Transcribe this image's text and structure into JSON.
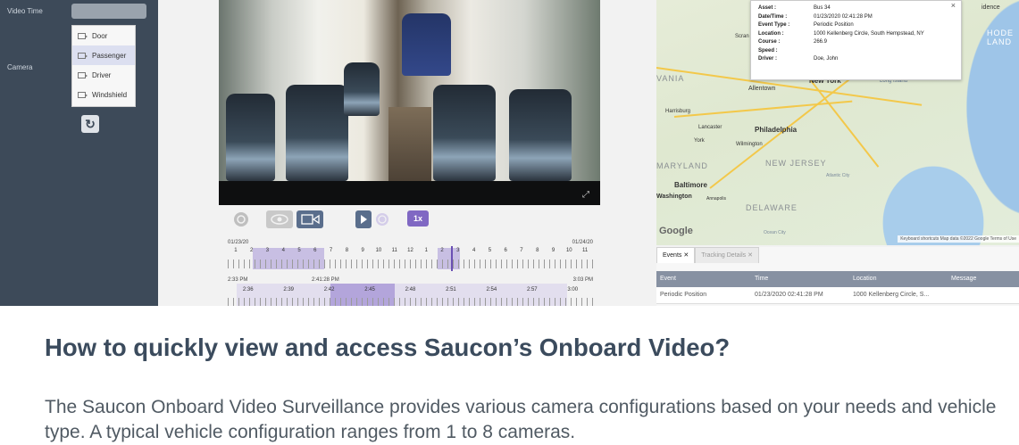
{
  "left_panel": {
    "video_time_label": "Video Time",
    "camera_label": "Camera",
    "cameras": [
      "Door",
      "Passenger",
      "Driver",
      "Windshield"
    ],
    "selected_camera": "Passenger",
    "icons": {
      "refresh": "refresh-icon",
      "camera": "camera-icon"
    }
  },
  "player": {
    "speed_label": "1x",
    "icons": [
      "sync-icon",
      "eye-icon",
      "video-camera-icon",
      "play-icon",
      "history-icon",
      "expand-icon"
    ]
  },
  "timeline": {
    "day_start": "01/23/20",
    "day_end": "01/24/20",
    "hours": [
      "1",
      "2",
      "3",
      "4",
      "5",
      "6",
      "7",
      "8",
      "9",
      "10",
      "11",
      "12",
      "1",
      "2",
      "3",
      "4",
      "5",
      "6",
      "7",
      "8",
      "9",
      "10",
      "11"
    ],
    "time_start": "2:33 PM",
    "time_cursor": "2:41:28 PM",
    "time_end": "3:03 PM",
    "minutes": [
      "2:36",
      "2:39",
      "2:42",
      "2:45",
      "2:48",
      "2:51",
      "2:54",
      "2:57",
      "3:00"
    ]
  },
  "map": {
    "info": [
      {
        "key": "Asset :",
        "value": "Bus 34"
      },
      {
        "key": "Date/Time :",
        "value": "01/23/2020 02:41:28 PM"
      },
      {
        "key": "Event Type :",
        "value": "Periodic Position"
      },
      {
        "key": "Location :",
        "value": "1000 Kellenberg Circle, South Hempstead, NY"
      },
      {
        "key": "Course :",
        "value": "266.9"
      },
      {
        "key": "Speed :",
        "value": ""
      },
      {
        "key": "Driver :",
        "value": "Doe, John"
      }
    ],
    "close": "×",
    "cities": {
      "new_york": "New York",
      "allentown": "Allentown",
      "harrisburg": "Harrisburg",
      "lancaster": "Lancaster",
      "york": "York",
      "philadelphia": "Philadelphia",
      "wilmington": "Wilmington",
      "baltimore": "Baltimore",
      "washington": "Washington",
      "annapolis": "Annapolis",
      "atlantic_city": "Atlantic City",
      "ocean_city": "Ocean City",
      "long_island": "Long Island"
    },
    "regions": {
      "vania": "VANIA",
      "maryland": "MARYLAND",
      "new_jersey": "NEW JERSEY",
      "delaware": "DELAWARE",
      "rhode_island_1": "HODE",
      "rhode_island_2": "LAND",
      "providence": "idence",
      "scranton": "Scran"
    },
    "google": "Google",
    "attribution": "Keyboard shortcuts   Map data ©2022 Google   Terms of Use"
  },
  "events": {
    "tabs": [
      "Events ✕",
      "Tracking Details ✕"
    ],
    "columns": [
      "Event",
      "Time",
      "Location",
      "Message"
    ],
    "rows": [
      [
        "Periodic Position",
        "01/23/2020 02:41:28 PM",
        "1000 Kellenberg Circle, S...",
        ""
      ]
    ]
  },
  "article": {
    "title": "How to quickly view and access Saucon’s Onboard Video?",
    "body": "The Saucon Onboard Video Surveillance provides various camera configurations based on your needs and vehicle type. A typical vehicle configuration ranges from 1 to 8 cameras."
  }
}
